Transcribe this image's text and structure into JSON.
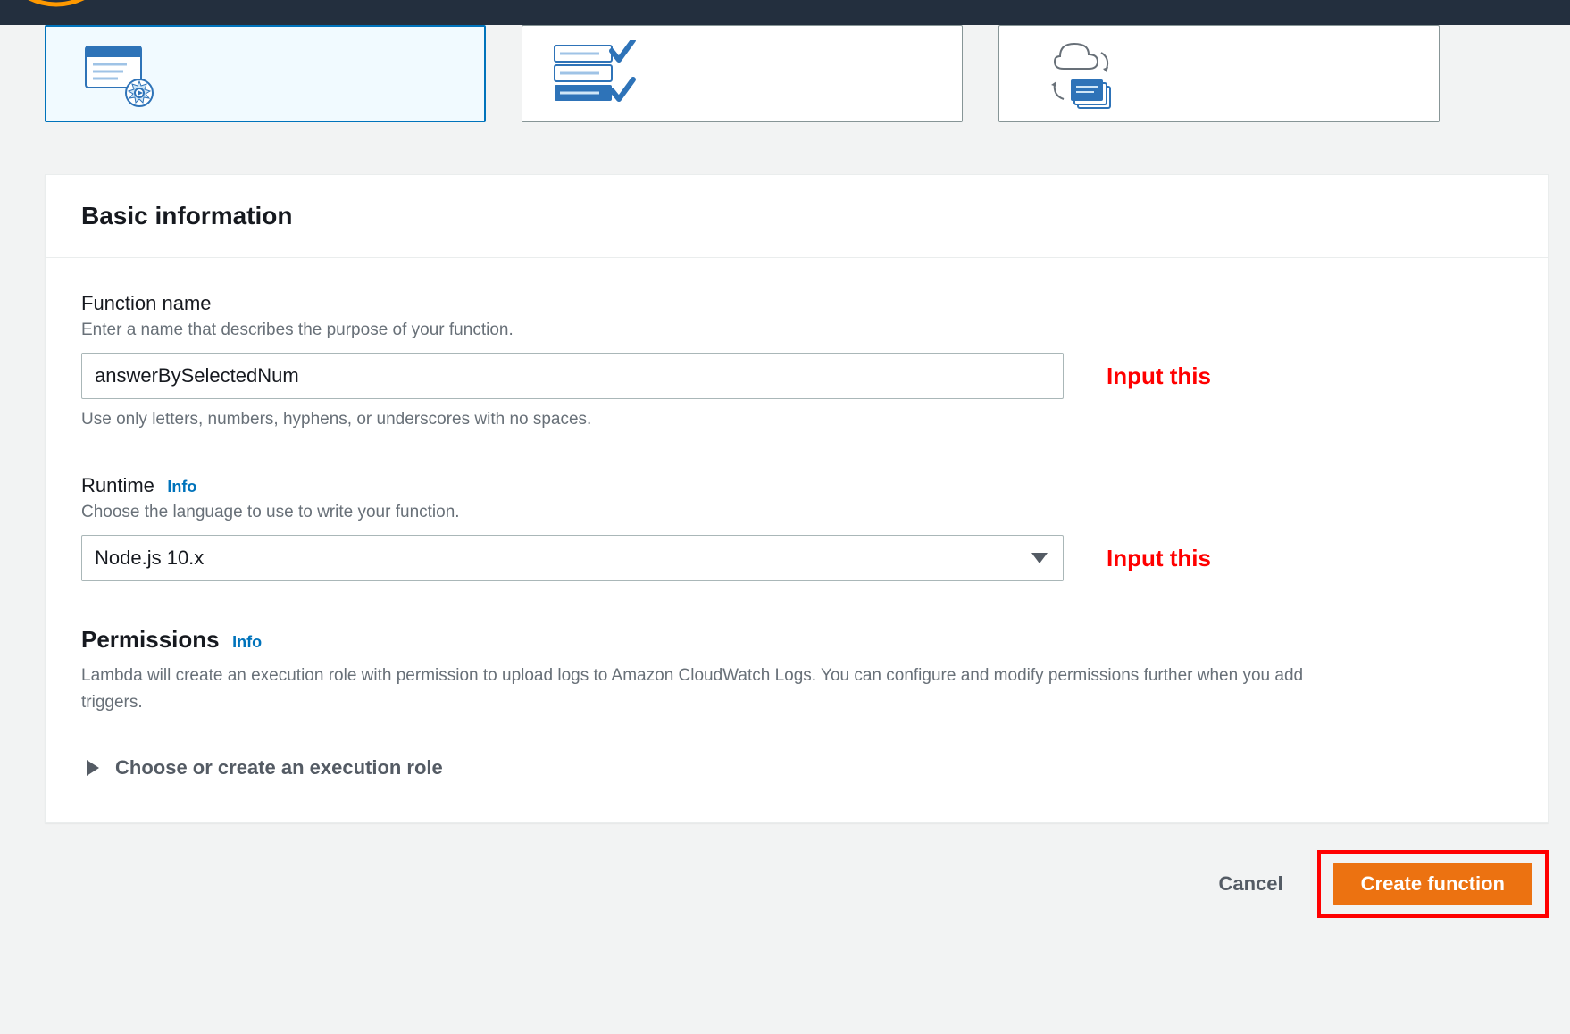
{
  "panel": {
    "title": "Basic information"
  },
  "functionName": {
    "label": "Function name",
    "description": "Enter a name that describes the purpose of your function.",
    "value": "answerBySelectedNum",
    "help": "Use only letters, numbers, hyphens, or underscores with no spaces.",
    "annotation": "Input this"
  },
  "runtime": {
    "label": "Runtime",
    "infoLabel": "Info",
    "description": "Choose the language to use to write your function.",
    "value": "Node.js 10.x",
    "annotation": "Input this"
  },
  "permissions": {
    "heading": "Permissions",
    "infoLabel": "Info",
    "description": "Lambda will create an execution role with permission to upload logs to Amazon CloudWatch Logs. You can configure and modify permissions further when you add triggers.",
    "expanderLabel": "Choose or create an execution role"
  },
  "footer": {
    "cancel": "Cancel",
    "create": "Create function"
  }
}
